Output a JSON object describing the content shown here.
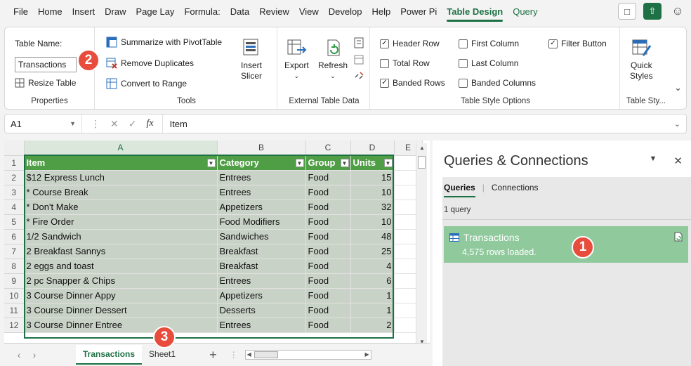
{
  "menu": {
    "tabs": [
      "File",
      "Home",
      "Insert",
      "Draw",
      "Page Lay",
      "Formula:",
      "Data",
      "Review",
      "View",
      "Develop",
      "Help",
      "Power Pi",
      "Table Design",
      "Query"
    ],
    "active": "Table Design"
  },
  "ribbon": {
    "properties": {
      "table_name_label": "Table Name:",
      "table_name_value": "Transactions",
      "resize_label": "Resize Table",
      "group_label": "Properties"
    },
    "tools": {
      "summarize_label": "Summarize with PivotTable",
      "remove_dup_label": "Remove Duplicates",
      "convert_label": "Convert to Range",
      "insert_slicer_line1": "Insert",
      "insert_slicer_line2": "Slicer",
      "group_label": "Tools"
    },
    "external": {
      "export_label": "Export",
      "refresh_label": "Refresh",
      "group_label": "External Table Data"
    },
    "style_options": {
      "header_row": "Header Row",
      "total_row": "Total Row",
      "banded_rows": "Banded Rows",
      "first_column": "First Column",
      "last_column": "Last Column",
      "banded_columns": "Banded Columns",
      "filter_button": "Filter Button",
      "group_label": "Table Style Options"
    },
    "styles": {
      "quick_line1": "Quick",
      "quick_line2": "Styles",
      "group_label": "Table Sty..."
    }
  },
  "formula_bar": {
    "name_box": "A1",
    "content": "Item"
  },
  "grid": {
    "columns": [
      "A",
      "B",
      "C",
      "D",
      "E"
    ],
    "headers": [
      "Item",
      "Category",
      "Group",
      "Units"
    ],
    "rows": [
      {
        "n": "2",
        "item": "$12 Express Lunch",
        "category": "Entrees",
        "group": "Food",
        "units": "15"
      },
      {
        "n": "3",
        "item": "* Course Break",
        "category": "Entrees",
        "group": "Food",
        "units": "10"
      },
      {
        "n": "4",
        "item": "* Don't Make",
        "category": "Appetizers",
        "group": "Food",
        "units": "32"
      },
      {
        "n": "5",
        "item": "* Fire Order",
        "category": "Food Modifiers",
        "group": "Food",
        "units": "10"
      },
      {
        "n": "6",
        "item": "1/2 Sandwich",
        "category": "Sandwiches",
        "group": "Food",
        "units": "48"
      },
      {
        "n": "7",
        "item": "2 Breakfast Sannys",
        "category": "Breakfast",
        "group": "Food",
        "units": "25"
      },
      {
        "n": "8",
        "item": "2 eggs and toast",
        "category": "Breakfast",
        "group": "Food",
        "units": "4"
      },
      {
        "n": "9",
        "item": "2 pc Snapper & Chips",
        "category": "Entrees",
        "group": "Food",
        "units": "6"
      },
      {
        "n": "10",
        "item": "3 Course Dinner Appy",
        "category": "Appetizers",
        "group": "Food",
        "units": "1"
      },
      {
        "n": "11",
        "item": "3 Course Dinner Dessert",
        "category": "Desserts",
        "group": "Food",
        "units": "1"
      },
      {
        "n": "12",
        "item": "3 Course Dinner Entree",
        "category": "Entrees",
        "group": "Food",
        "units": "2"
      }
    ]
  },
  "sheets": {
    "tabs": [
      "Transactions",
      "Sheet1"
    ],
    "active": "Transactions"
  },
  "queries_pane": {
    "title": "Queries & Connections",
    "tab_queries": "Queries",
    "tab_connections": "Connections",
    "count": "1 query",
    "item_name": "Transactions",
    "item_rows": "4,575 rows loaded."
  },
  "badges": [
    "1",
    "2",
    "3"
  ],
  "colors": {
    "accent": "#1e7145",
    "table_header": "#4f9e45",
    "table_body": "#c9d2c7",
    "query_item": "#8fc99c",
    "badge": "#e74c3c"
  }
}
